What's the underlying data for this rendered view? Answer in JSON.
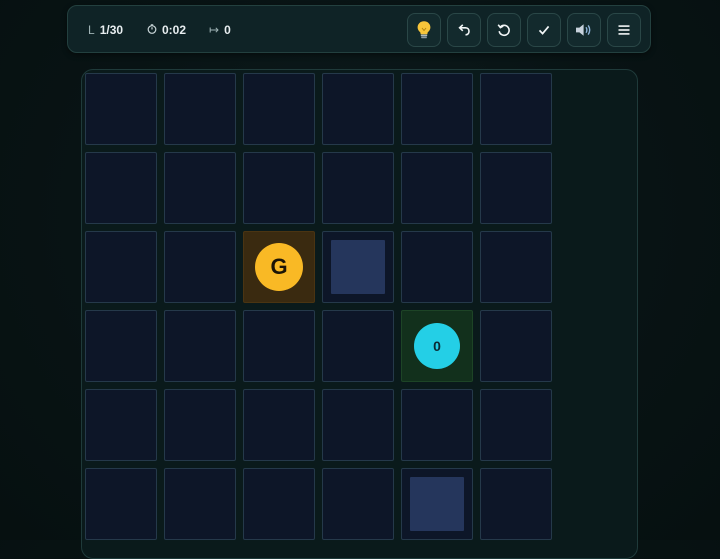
{
  "hud": {
    "level": "1/30",
    "time": "0:02",
    "moves": "0",
    "icons": {
      "level": "level-icon",
      "time": "timer-icon",
      "moves": "moves-icon"
    },
    "buttons": [
      {
        "name": "hint-button",
        "icon": "lightbulb-icon"
      },
      {
        "name": "undo-button",
        "icon": "undo-icon"
      },
      {
        "name": "restart-button",
        "icon": "restart-icon"
      },
      {
        "name": "check-button",
        "icon": "checkmark-icon"
      },
      {
        "name": "sound-button",
        "icon": "speaker-icon"
      },
      {
        "name": "menu-button",
        "icon": "menu-icon"
      }
    ]
  },
  "board": {
    "columns": 6,
    "visible_rows": 6,
    "cells": [
      [
        {
          "type": "empty"
        },
        {
          "type": "empty"
        },
        {
          "type": "empty"
        },
        {
          "type": "empty"
        },
        {
          "type": "empty"
        },
        {
          "type": "empty"
        }
      ],
      [
        {
          "type": "empty"
        },
        {
          "type": "empty"
        },
        {
          "type": "empty"
        },
        {
          "type": "empty"
        },
        {
          "type": "empty"
        },
        {
          "type": "empty"
        }
      ],
      [
        {
          "type": "empty"
        },
        {
          "type": "empty"
        },
        {
          "type": "goal",
          "label": "G"
        },
        {
          "type": "block"
        },
        {
          "type": "empty"
        },
        {
          "type": "empty"
        }
      ],
      [
        {
          "type": "empty"
        },
        {
          "type": "empty"
        },
        {
          "type": "empty"
        },
        {
          "type": "empty"
        },
        {
          "type": "player",
          "label": "0"
        },
        {
          "type": "empty"
        }
      ],
      [
        {
          "type": "empty"
        },
        {
          "type": "empty"
        },
        {
          "type": "empty"
        },
        {
          "type": "empty"
        },
        {
          "type": "empty"
        },
        {
          "type": "empty"
        }
      ],
      [
        {
          "type": "empty"
        },
        {
          "type": "empty"
        },
        {
          "type": "empty"
        },
        {
          "type": "empty"
        },
        {
          "type": "block"
        },
        {
          "type": "empty"
        }
      ]
    ]
  },
  "colors": {
    "background": "#081314",
    "tile": "#0d1628",
    "tile_border": "#25394a",
    "block": "#25365c",
    "goal": "#f9b925",
    "goal_tile": "#3a2a10",
    "player": "#24cfe6",
    "player_tile": "#12301c"
  }
}
